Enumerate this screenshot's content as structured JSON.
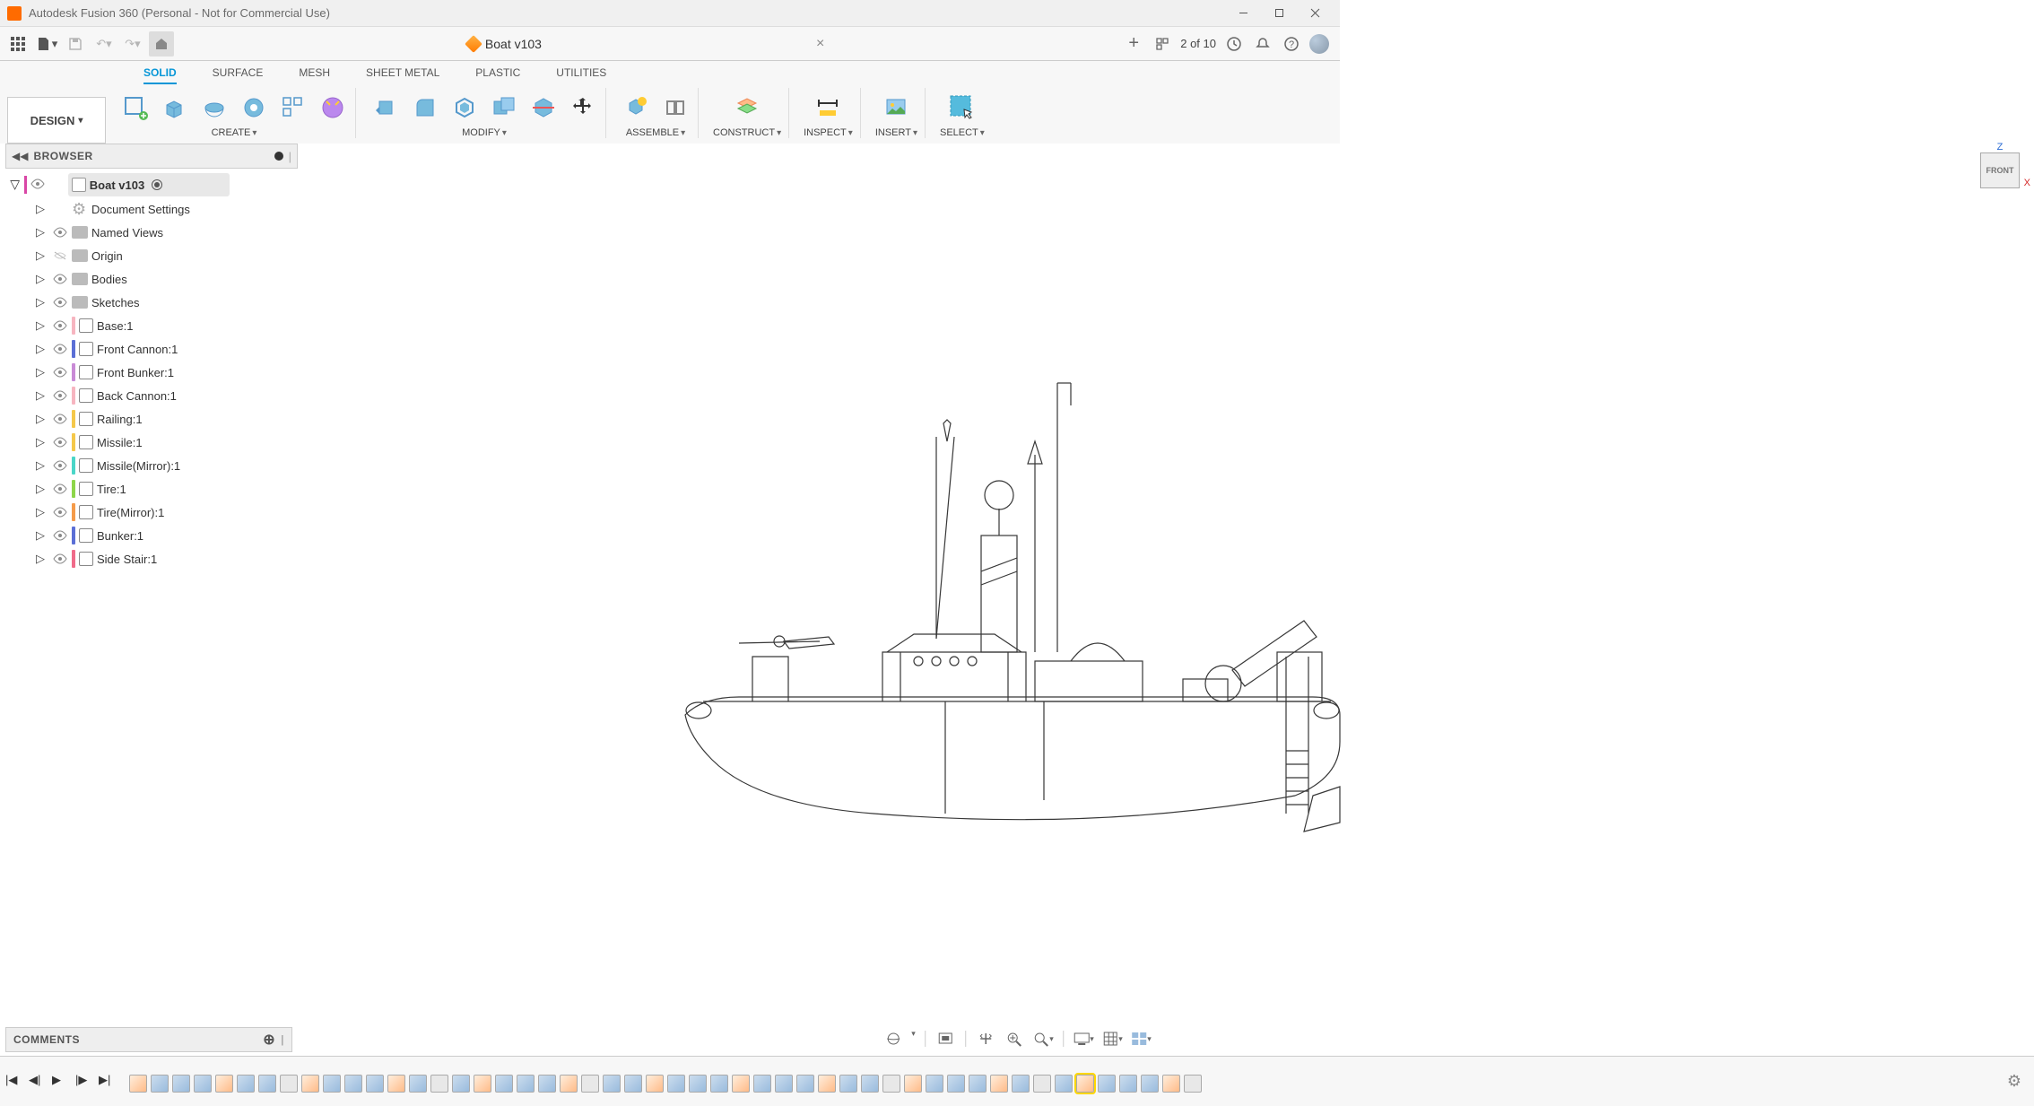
{
  "titlebar": {
    "title": "Autodesk Fusion 360 (Personal - Not for Commercial Use)"
  },
  "quickbar": {
    "doc_name": "Boat v103",
    "counter": "2 of 10"
  },
  "ribbon": {
    "tabs": [
      "SOLID",
      "SURFACE",
      "MESH",
      "SHEET METAL",
      "PLASTIC",
      "UTILITIES"
    ],
    "active_tab": "SOLID",
    "workspace": "DESIGN",
    "groups": {
      "create": "CREATE",
      "modify": "MODIFY",
      "assemble": "ASSEMBLE",
      "construct": "CONSTRUCT",
      "inspect": "INSPECT",
      "insert": "INSERT",
      "select": "SELECT"
    }
  },
  "browser": {
    "title": "BROWSER",
    "root": "Boat v103",
    "items": [
      {
        "label": "Document Settings",
        "type": "gear"
      },
      {
        "label": "Named Views",
        "type": "folder"
      },
      {
        "label": "Origin",
        "type": "folder",
        "hidden": true
      },
      {
        "label": "Bodies",
        "type": "folder"
      },
      {
        "label": "Sketches",
        "type": "folder"
      }
    ],
    "components": [
      {
        "label": "Base:1",
        "color": "#f7b5c0"
      },
      {
        "label": "Front Cannon:1",
        "color": "#5b6fd6"
      },
      {
        "label": "Front Bunker:1",
        "color": "#c98bd6"
      },
      {
        "label": "Back Cannon:1",
        "color": "#f7b5c0"
      },
      {
        "label": "Railing:1",
        "color": "#f5c84a"
      },
      {
        "label": "Missile:1",
        "color": "#f5c84a"
      },
      {
        "label": "Missile(Mirror):1",
        "color": "#4ad6c8"
      },
      {
        "label": "Tire:1",
        "color": "#8ed64a"
      },
      {
        "label": "Tire(Mirror):1",
        "color": "#f59b4a"
      },
      {
        "label": "Bunker:1",
        "color": "#5b6fd6"
      },
      {
        "label": "Side Stair:1",
        "color": "#f06b8a"
      }
    ]
  },
  "viewcube": {
    "face": "FRONT",
    "axes": {
      "z": "Z",
      "x": "X"
    }
  },
  "comments": {
    "title": "COMMENTS"
  },
  "timeline": {
    "bar_segments": [
      {
        "color": "#f7b5c0",
        "width": "28%"
      },
      {
        "color": "#5b6fd6",
        "width": "9%"
      },
      {
        "color": "#c98bd6",
        "width": "8%"
      },
      {
        "color": "#f7b5c0",
        "width": "10%"
      },
      {
        "color": "#f5c84a",
        "width": "7%"
      },
      {
        "color": "#f5c84a",
        "width": "6%"
      },
      {
        "color": "#f59b4a",
        "width": "8%"
      },
      {
        "color": "#5b6fd6",
        "width": "6%"
      },
      {
        "color": "#f5c84a",
        "width": "7%"
      },
      {
        "color": "#f5c84a",
        "width": "3%"
      },
      {
        "color": "#f06b8a",
        "width": "8%"
      }
    ]
  }
}
